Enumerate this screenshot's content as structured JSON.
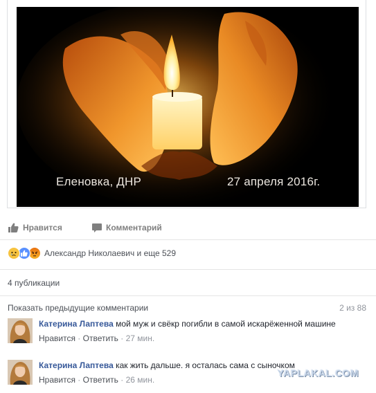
{
  "photo": {
    "caption_place": "Еленовка, ДНР",
    "caption_date": "27 апреля 2016г."
  },
  "actions": {
    "like_label": "Нравится",
    "comment_label": "Комментарий"
  },
  "reactions": {
    "icons": [
      "sad-reaction-icon",
      "like-reaction-icon",
      "angry-reaction-icon"
    ],
    "summary": "Александр Николаевич и еще 529"
  },
  "shares": {
    "label": "4 публикации"
  },
  "comments_section": {
    "prev_label": "Показать предыдущие комментарии",
    "count": "2 из 88",
    "items": [
      {
        "author": "Катерина Лаптева",
        "text": "мой муж и свёкр погибли в самой искарёженной машине",
        "like": "Нравится",
        "reply": "Ответить",
        "time": "27 мин."
      },
      {
        "author": "Катерина Лаптева",
        "text": "как жить дальше. я осталась сама с сыночком",
        "like": "Нравится",
        "reply": "Ответить",
        "time": "26 мин."
      }
    ]
  },
  "watermark": "YAPLAKAL.COM",
  "colors": {
    "link_blue": "#365899",
    "meta_gray": "#90949c",
    "action_gray": "#7f7f7f",
    "like_blue": "#5890ff",
    "sad_yellow": "#f7c33f"
  }
}
